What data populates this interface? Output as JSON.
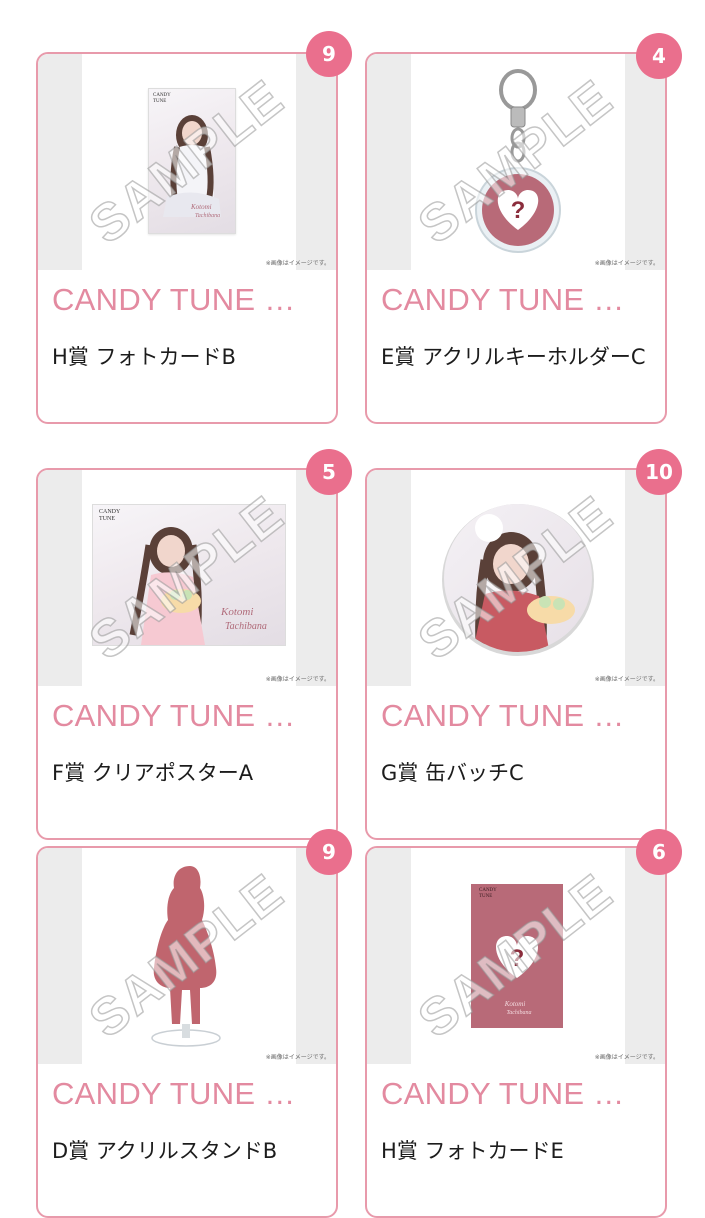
{
  "cards": [
    {
      "count": "9",
      "title": "CANDY TUNE …",
      "prize": "H賞 フォトカードB",
      "note": "※画像はイメージです。",
      "watermark": "SAMPLE",
      "item_logo": "CANDY TUNE",
      "item_type": "photo-card"
    },
    {
      "count": "4",
      "title": "CANDY TUNE …",
      "prize": "E賞 アクリルキーホルダーC",
      "note": "※画像はイメージです。",
      "watermark": "SAMPLE",
      "item_type": "acrylic-keyholder"
    },
    {
      "count": "5",
      "title": "CANDY TUNE …",
      "prize": "F賞 クリアポスターA",
      "note": "※画像はイメージです。",
      "watermark": "SAMPLE",
      "item_logo": "CANDY TUNE",
      "item_type": "clear-poster"
    },
    {
      "count": "10",
      "title": "CANDY TUNE …",
      "prize": "G賞 缶バッチC",
      "note": "※画像はイメージです。",
      "watermark": "SAMPLE",
      "item_type": "can-badge"
    },
    {
      "count": "9",
      "title": "CANDY TUNE …",
      "prize": "D賞 アクリルスタンドB",
      "note": "※画像はイメージです。",
      "watermark": "SAMPLE",
      "item_type": "acrylic-stand"
    },
    {
      "count": "6",
      "title": "CANDY TUNE …",
      "prize": "H賞 フォトカードE",
      "note": "※画像はイメージです。",
      "watermark": "SAMPLE",
      "item_logo": "CANDY TUNE",
      "item_type": "secret-photo-card"
    }
  ],
  "colors": {
    "accent": "#ea6f8d",
    "border": "#e89aab",
    "title": "#e38aa0",
    "mystery": "#b86a78"
  }
}
